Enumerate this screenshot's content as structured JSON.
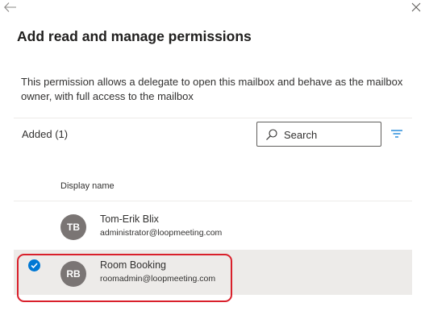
{
  "panel": {
    "title": "Add read and manage permissions",
    "description": "This permission allows a delegate to open this mailbox and behave as the mailbox owner, with full access to the mailbox"
  },
  "toolbar": {
    "added_label": "Added (1)",
    "search_placeholder": "Search"
  },
  "table": {
    "column_header": "Display name",
    "rows": [
      {
        "initials": "TB",
        "name": "Tom-Erik Blix",
        "email": "administrator@loopmeeting.com",
        "selected": false
      },
      {
        "initials": "RB",
        "name": "Room Booking",
        "email": "roomadmin@loopmeeting.com",
        "selected": true
      }
    ]
  },
  "colors": {
    "accent": "#0078d4",
    "avatar": "#7a7574",
    "selected_row": "#edebe9",
    "highlight_border": "#d9202b"
  },
  "icons": {
    "back": "back-arrow-icon",
    "close": "close-icon",
    "search": "search-icon",
    "filter": "filter-icon",
    "check": "checkmark-circle-icon"
  }
}
